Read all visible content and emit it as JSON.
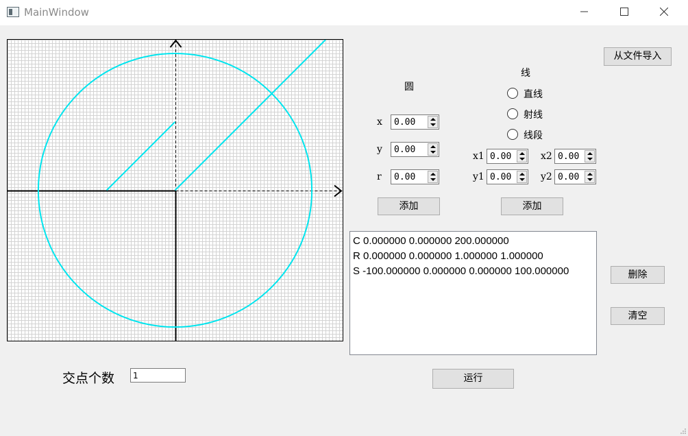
{
  "window": {
    "title": "MainWindow"
  },
  "canvas": {
    "x_range": [
      -245,
      245
    ],
    "y_range": [
      -220,
      220
    ],
    "grid_step": 5,
    "colors": {
      "grid": "#d3d3d3",
      "axis": "#000000",
      "shape": "#00e5ee"
    },
    "shapes": [
      {
        "kind": "circle",
        "cx": 0,
        "cy": 0,
        "r": 200
      },
      {
        "kind": "ray",
        "x1": 0,
        "y1": 0,
        "x2": 1,
        "y2": 1
      },
      {
        "kind": "segment",
        "x1": -100,
        "y1": 0,
        "x2": 0,
        "y2": 100
      }
    ]
  },
  "import_button": "从文件导入",
  "circle_panel": {
    "title": "圆",
    "x_label": "x",
    "y_label": "y",
    "r_label": "r",
    "x_value": "0.00",
    "y_value": "0.00",
    "r_value": "0.00",
    "add_button": "添加"
  },
  "line_panel": {
    "title": "线",
    "options": [
      "直线",
      "射线",
      "线段"
    ],
    "x1_label": "x1",
    "y1_label": "y1",
    "x2_label": "x2",
    "y2_label": "y2",
    "x1_value": "0.00",
    "y1_value": "0.00",
    "x2_value": "0.00",
    "y2_value": "0.00",
    "add_button": "添加"
  },
  "shape_list": [
    "C 0.000000 0.000000 200.000000",
    "R 0.000000 0.000000 1.000000 1.000000",
    "S -100.000000 0.000000 0.000000 100.000000"
  ],
  "delete_button": "删除",
  "clear_button": "清空",
  "run_button": "运行",
  "intersections": {
    "label": "交点个数",
    "value": "1"
  }
}
